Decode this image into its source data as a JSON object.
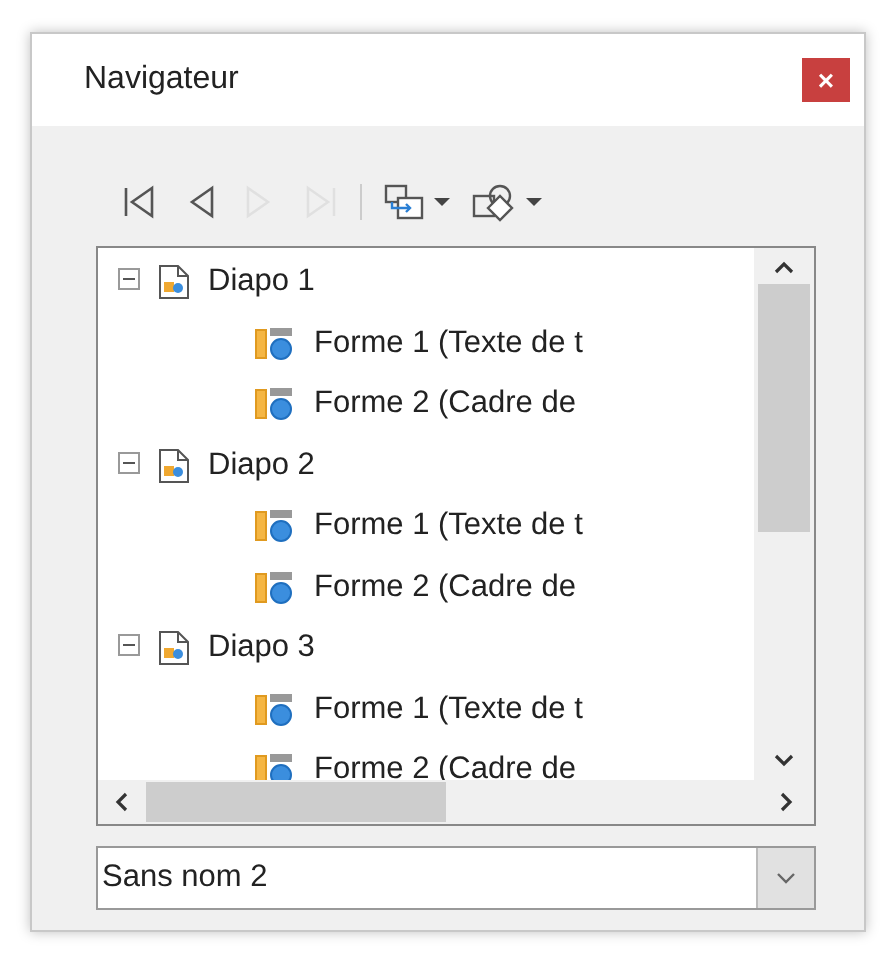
{
  "window": {
    "title": "Navigateur",
    "close": "×"
  },
  "toolbar": [
    {
      "kind": "first",
      "disabled": false
    },
    {
      "kind": "prev",
      "disabled": false
    },
    {
      "kind": "next",
      "disabled": true
    },
    {
      "kind": "last",
      "disabled": true
    },
    {
      "kind": "sep"
    },
    {
      "kind": "dragmode",
      "disabled": false
    },
    {
      "kind": "shapes",
      "disabled": false
    }
  ],
  "tree": [
    {
      "label": "Diapo 1",
      "expanded": true,
      "children": [
        {
          "label": "Forme 1 (Texte de t"
        },
        {
          "label": "Forme 2 (Cadre de"
        }
      ]
    },
    {
      "label": "Diapo 2",
      "expanded": true,
      "children": [
        {
          "label": "Forme 1 (Texte de t"
        },
        {
          "label": "Forme 2 (Cadre de"
        }
      ]
    },
    {
      "label": "Diapo 3",
      "expanded": true,
      "children": [
        {
          "label": "Forme 1 (Texte de t"
        },
        {
          "label": "Forme 2 (Cadre de"
        }
      ]
    }
  ],
  "document_select": {
    "value": "Sans nom 2"
  }
}
